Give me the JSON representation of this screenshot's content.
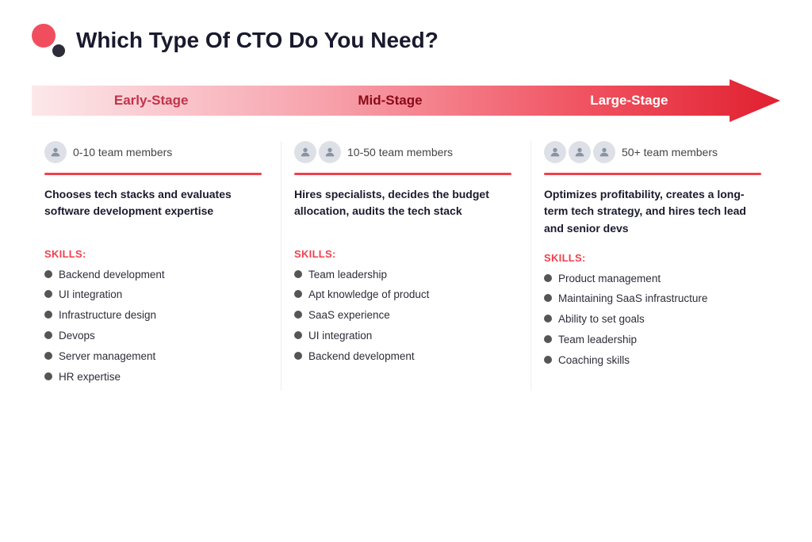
{
  "header": {
    "title": "Which Type Of CTO Do You Need?"
  },
  "arrow": {
    "stages": [
      {
        "label": "Early-Stage",
        "color": "#f47a88"
      },
      {
        "label": "Mid-Stage",
        "color": "#f0404e"
      },
      {
        "label": "Large-Stage",
        "color": "#d42b3c"
      }
    ]
  },
  "columns": [
    {
      "id": "early",
      "stage": "Early-Stage",
      "person_count": 1,
      "team_count": "0-10 team members",
      "description": "Chooses tech stacks and evaluates software development expertise",
      "skills_label": "SKILLS:",
      "skills": [
        "Backend development",
        "UI integration",
        "Infrastructure design",
        "Devops",
        "Server management",
        "HR expertise"
      ]
    },
    {
      "id": "mid",
      "stage": "Mid-Stage",
      "person_count": 2,
      "team_count": "10-50 team members",
      "description": "Hires specialists, decides the budget allocation, audits the tech stack",
      "skills_label": "SKILLS:",
      "skills": [
        "Team leadership",
        "Apt knowledge of product",
        "SaaS experience",
        "UI integration",
        "Backend development"
      ]
    },
    {
      "id": "large",
      "stage": "Large-Stage",
      "person_count": 3,
      "team_count": "50+ team members",
      "description": "Optimizes profitability, creates a long-term tech strategy, and hires tech lead and senior devs",
      "skills_label": "SKILLS:",
      "skills": [
        "Product management",
        "Maintaining SaaS infrastructure",
        "Ability to set goals",
        "Team leadership",
        "Coaching skills"
      ]
    }
  ]
}
